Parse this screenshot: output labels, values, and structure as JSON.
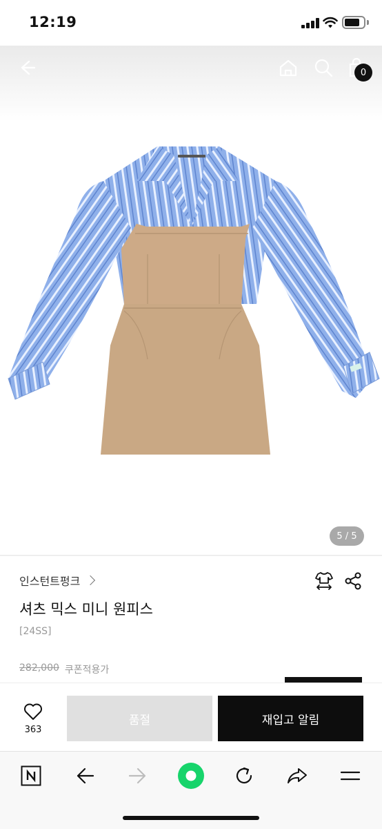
{
  "status_bar": {
    "time": "12:19"
  },
  "header": {
    "cart_count": "0"
  },
  "gallery": {
    "page_indicator": "5 / 5"
  },
  "product": {
    "brand": "인스턴트펑크",
    "title": "셔츠 믹스 미니 원피스",
    "season": "[24SS]",
    "original_price": "282,000",
    "coupon_label": "쿠폰적용가"
  },
  "actions": {
    "like_count": "363",
    "soldout_label": "품절",
    "restock_label": "재입고 알림"
  },
  "colors": {
    "accent_green": "#17d46b",
    "button_dark": "#0d0d0d",
    "button_disabled": "#e0e0e0",
    "shirt_blue": "#8fb0ea",
    "dress_beige": "#c9a884"
  }
}
